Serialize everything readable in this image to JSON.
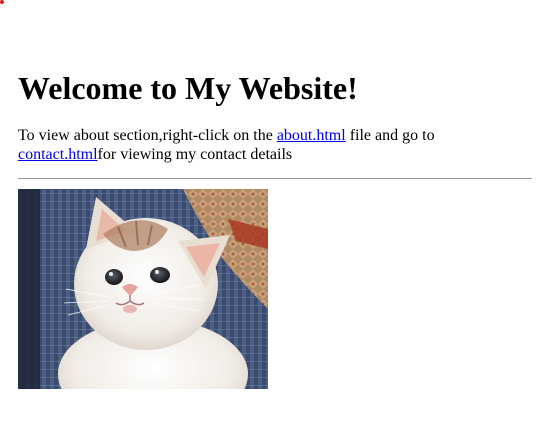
{
  "page": {
    "heading": "Welcome to My Website!",
    "intro": {
      "text_before": "To view about section,right-click on the ",
      "about_link": "about.html",
      "text_middle": " file and go to ",
      "contact_link": "contact.html",
      "text_after": "for viewing my contact details"
    },
    "image": {
      "subject": "kitten photo"
    }
  },
  "colors": {
    "link": "#0000ee",
    "divider": "#9a9a9a",
    "corner_dot": "#e01b1b"
  }
}
